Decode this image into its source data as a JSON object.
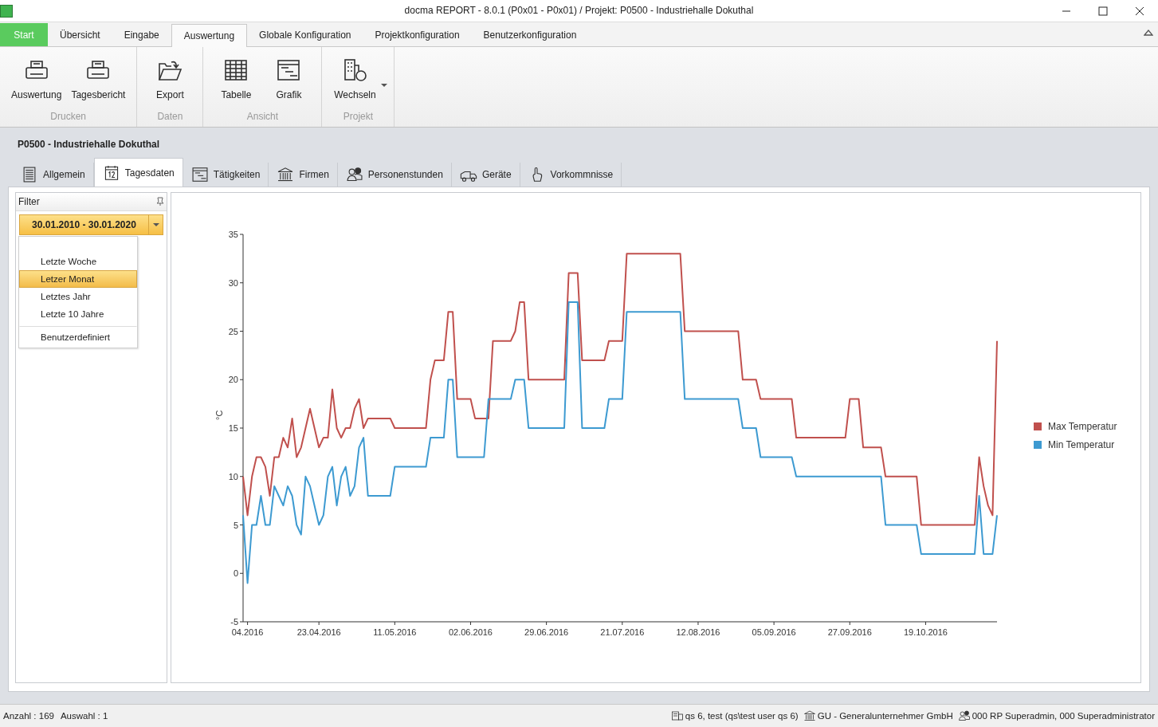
{
  "window": {
    "title": "docma REPORT - 8.0.1 (P0x01 - P0x01) / Projekt: P0500  - Industriehalle Dokuthal"
  },
  "ribbon": {
    "tabs": [
      {
        "label": "Start",
        "kind": "start",
        "selected": false
      },
      {
        "label": "Übersicht",
        "kind": "tab",
        "selected": false
      },
      {
        "label": "Eingabe",
        "kind": "tab",
        "selected": false
      },
      {
        "label": "Auswertung",
        "kind": "tab",
        "selected": true
      },
      {
        "label": "Globale Konfiguration",
        "kind": "tab",
        "selected": false
      },
      {
        "label": "Projektkonfiguration",
        "kind": "tab",
        "selected": false
      },
      {
        "label": "Benutzerkonfiguration",
        "kind": "tab",
        "selected": false
      }
    ],
    "groups": [
      {
        "label": "Drucken",
        "buttons": [
          {
            "label": "Auswertung"
          },
          {
            "label": "Tagesbericht"
          }
        ]
      },
      {
        "label": "Daten",
        "buttons": [
          {
            "label": "Export"
          }
        ]
      },
      {
        "label": "Ansicht",
        "buttons": [
          {
            "label": "Tabelle"
          },
          {
            "label": "Grafik"
          }
        ]
      },
      {
        "label": "Projekt",
        "buttons": [
          {
            "label": "Wechseln",
            "dropdown": true
          }
        ]
      }
    ]
  },
  "project": {
    "title": "P0500  - Industriehalle Dokuthal"
  },
  "tabs": [
    {
      "label": "Allgemein",
      "selected": false
    },
    {
      "label": "Tagesdaten",
      "selected": true
    },
    {
      "label": "Tätigkeiten",
      "selected": false
    },
    {
      "label": "Firmen",
      "selected": false
    },
    {
      "label": "Personenstunden",
      "selected": false
    },
    {
      "label": "Geräte",
      "selected": false
    },
    {
      "label": "Vorkommnisse",
      "selected": false
    }
  ],
  "filter": {
    "title": "Filter",
    "range": "30.01.2010 - 30.01.2020",
    "menu": [
      {
        "label": "Letzte Woche",
        "kind": "option",
        "selected": false
      },
      {
        "label": "Letzer Monat",
        "kind": "option",
        "selected": true
      },
      {
        "label": "Letztes Jahr",
        "kind": "option",
        "selected": false
      },
      {
        "label": "Letzte 10 Jahre",
        "kind": "option",
        "selected": false
      },
      {
        "label": "Benutzerdefiniert",
        "kind": "separated",
        "selected": false
      }
    ]
  },
  "chart": {
    "chart_data": {
      "type": "line",
      "legend": "right",
      "ylabel": "°C",
      "ylim": [
        -5,
        35
      ],
      "yticks": [
        -5,
        0,
        5,
        10,
        15,
        20,
        25,
        30,
        35
      ],
      "categories": [
        null,
        "04.2016",
        null,
        null,
        null,
        null,
        null,
        null,
        null,
        null,
        null,
        null,
        null,
        null,
        null,
        null,
        null,
        "23.04.2016",
        null,
        null,
        null,
        null,
        null,
        null,
        null,
        null,
        null,
        null,
        null,
        null,
        null,
        null,
        null,
        null,
        "11.05.2016",
        null,
        null,
        null,
        null,
        null,
        null,
        null,
        null,
        null,
        null,
        null,
        null,
        null,
        null,
        null,
        null,
        "02.06.2016",
        null,
        null,
        null,
        null,
        null,
        null,
        null,
        null,
        null,
        null,
        null,
        null,
        null,
        null,
        null,
        null,
        "29.06.2016",
        null,
        null,
        null,
        null,
        null,
        null,
        null,
        null,
        null,
        null,
        null,
        null,
        null,
        null,
        null,
        null,
        "21.07.2016",
        null,
        null,
        null,
        null,
        null,
        null,
        null,
        null,
        null,
        null,
        null,
        null,
        null,
        null,
        null,
        null,
        "12.08.2016",
        null,
        null,
        null,
        null,
        null,
        null,
        null,
        null,
        null,
        null,
        null,
        null,
        null,
        null,
        null,
        null,
        "05.09.2016",
        null,
        null,
        null,
        null,
        null,
        null,
        null,
        null,
        null,
        null,
        null,
        null,
        null,
        null,
        null,
        null,
        "27.09.2016",
        null,
        null,
        null,
        null,
        null,
        null,
        null,
        null,
        null,
        null,
        null,
        null,
        null,
        null,
        null,
        null,
        "19.10.2016",
        null,
        null,
        null,
        null,
        null,
        null,
        null,
        null,
        null,
        null,
        null,
        null,
        null,
        null,
        null,
        null
      ],
      "series": [
        {
          "name": "Max Temperatur",
          "color": "#c0504d",
          "values": [
            10,
            6,
            10,
            12,
            12,
            11,
            8,
            12,
            12,
            14,
            13,
            16,
            12,
            13,
            15,
            17,
            15,
            13,
            14,
            14,
            19,
            15,
            14,
            15,
            15,
            17,
            18,
            15,
            16,
            16,
            16,
            16,
            16,
            16,
            15,
            15,
            15,
            15,
            15,
            15,
            15,
            15,
            20,
            22,
            22,
            22,
            27,
            27,
            18,
            18,
            18,
            18,
            16,
            16,
            16,
            16,
            24,
            24,
            24,
            24,
            24,
            25,
            28,
            28,
            20,
            20,
            20,
            20,
            20,
            20,
            20,
            20,
            20,
            31,
            31,
            31,
            22,
            22,
            22,
            22,
            22,
            22,
            24,
            24,
            24,
            24,
            33,
            33,
            33,
            33,
            33,
            33,
            33,
            33,
            33,
            33,
            33,
            33,
            33,
            25,
            25,
            25,
            25,
            25,
            25,
            25,
            25,
            25,
            25,
            25,
            25,
            25,
            20,
            20,
            20,
            20,
            18,
            18,
            18,
            18,
            18,
            18,
            18,
            18,
            14,
            14,
            14,
            14,
            14,
            14,
            14,
            14,
            14,
            14,
            14,
            14,
            18,
            18,
            18,
            13,
            13,
            13,
            13,
            13,
            10,
            10,
            10,
            10,
            10,
            10,
            10,
            10,
            5,
            5,
            5,
            5,
            5,
            5,
            5,
            5,
            5,
            5,
            5,
            5,
            5,
            12,
            9,
            7,
            6,
            24
          ]
        },
        {
          "name": "Min Temperatur",
          "color": "#3d9ad1",
          "values": [
            6,
            -1,
            5,
            5,
            8,
            5,
            5,
            9,
            8,
            7,
            9,
            8,
            5,
            4,
            10,
            9,
            7,
            5,
            6,
            10,
            11,
            7,
            10,
            11,
            8,
            9,
            13,
            14,
            8,
            8,
            8,
            8,
            8,
            8,
            11,
            11,
            11,
            11,
            11,
            11,
            11,
            11,
            14,
            14,
            14,
            14,
            20,
            20,
            12,
            12,
            12,
            12,
            12,
            12,
            12,
            18,
            18,
            18,
            18,
            18,
            18,
            20,
            20,
            20,
            15,
            15,
            15,
            15,
            15,
            15,
            15,
            15,
            15,
            28,
            28,
            28,
            15,
            15,
            15,
            15,
            15,
            15,
            18,
            18,
            18,
            18,
            27,
            27,
            27,
            27,
            27,
            27,
            27,
            27,
            27,
            27,
            27,
            27,
            27,
            18,
            18,
            18,
            18,
            18,
            18,
            18,
            18,
            18,
            18,
            18,
            18,
            18,
            15,
            15,
            15,
            15,
            12,
            12,
            12,
            12,
            12,
            12,
            12,
            12,
            10,
            10,
            10,
            10,
            10,
            10,
            10,
            10,
            10,
            10,
            10,
            10,
            10,
            10,
            10,
            10,
            10,
            10,
            10,
            10,
            5,
            5,
            5,
            5,
            5,
            5,
            5,
            5,
            2,
            2,
            2,
            2,
            2,
            2,
            2,
            2,
            2,
            2,
            2,
            2,
            2,
            8,
            2,
            2,
            2,
            6
          ]
        }
      ]
    }
  },
  "status_bar": {
    "left": [
      "Anzahl : 169",
      "Auswahl : 1"
    ],
    "right": [
      "qs 6, test (qs\\test user qs 6)",
      "GU - Generalunternehmer GmbH",
      "000 RP Superadmin, 000 Superadministrator"
    ]
  }
}
